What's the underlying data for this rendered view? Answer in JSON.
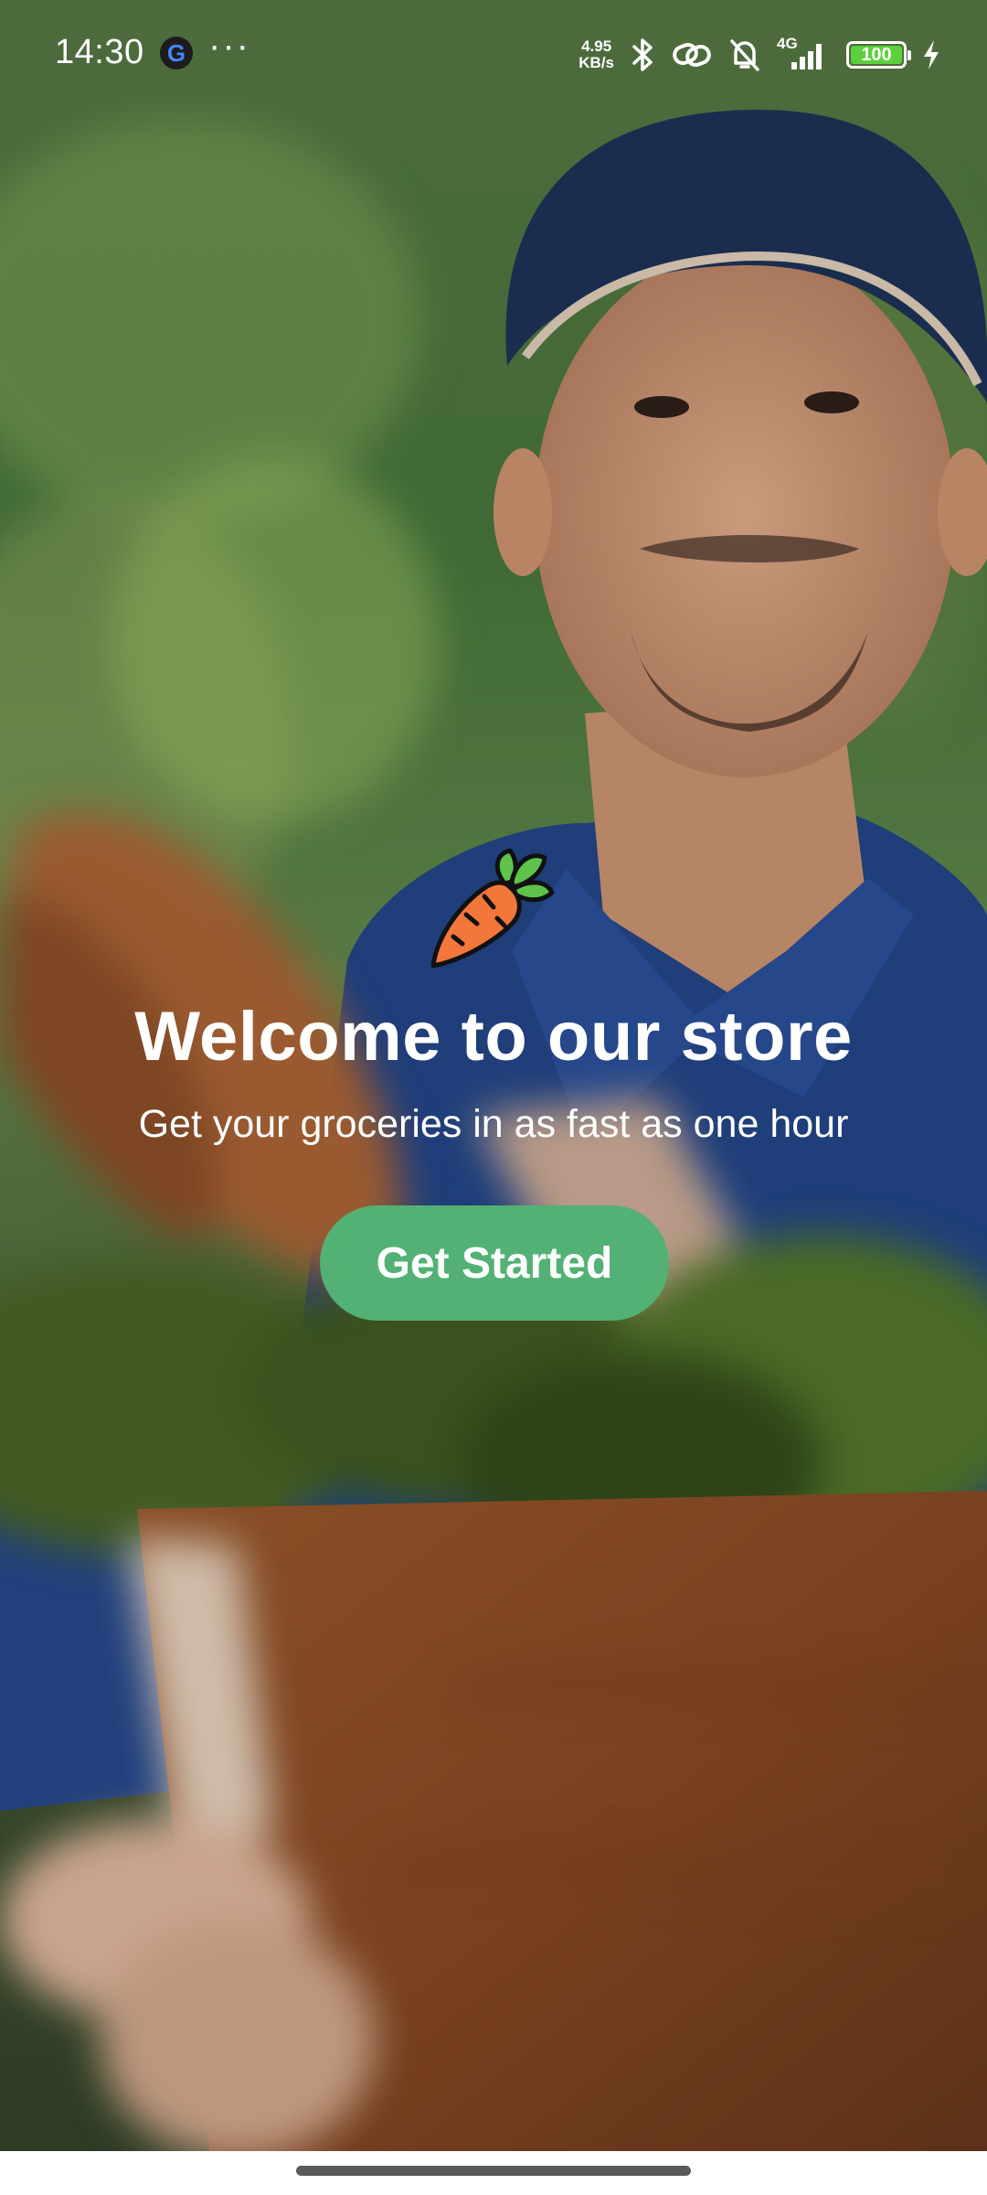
{
  "status_bar": {
    "time": "14:30",
    "notification_app": "G",
    "overflow": "···",
    "net_speed_value": "4.95",
    "net_speed_unit": "KB/s",
    "network_type": "4G",
    "battery_level": "100",
    "icons": [
      "google-icon",
      "more-notifications-icon",
      "bluetooth-icon",
      "link-icon",
      "mute-bell-icon",
      "signal-icon",
      "battery-icon",
      "charging-icon"
    ]
  },
  "welcome": {
    "logo_icon": "carrot-icon",
    "title": "Welcome to our store",
    "subtitle": "Get your groceries in as fast as one hour",
    "cta_label": "Get Started"
  },
  "colors": {
    "cta_background": "#53b175",
    "battery_fill": "#5ad13a",
    "carrot_body": "#f3773a",
    "carrot_leaves": "#5fc24a"
  }
}
